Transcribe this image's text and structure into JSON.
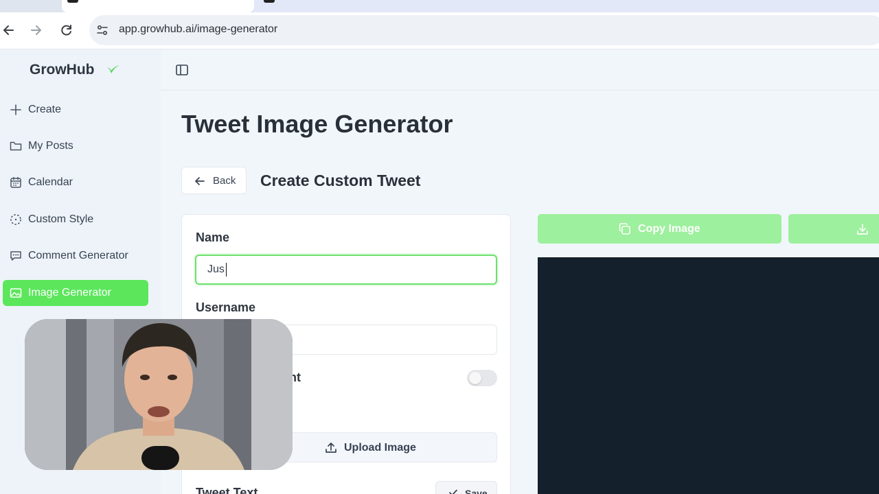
{
  "browser": {
    "url": "app.growhub.ai/image-generator"
  },
  "app": {
    "logo": "GrowHub"
  },
  "sidebar": {
    "items": [
      {
        "label": "Create",
        "icon": "plus-icon"
      },
      {
        "label": "My Posts",
        "icon": "folder-icon"
      },
      {
        "label": "Calendar",
        "icon": "calendar-icon"
      },
      {
        "label": "Custom Style",
        "icon": "dashed-circle-icon"
      },
      {
        "label": "Comment Generator",
        "icon": "comment-icon"
      },
      {
        "label": "Image Generator",
        "icon": "image-icon",
        "active": true
      }
    ]
  },
  "main": {
    "title": "Tweet Image Generator",
    "back_label": "Back",
    "subtitle": "Create Custom Tweet",
    "form": {
      "name_label": "Name",
      "name_value": "Jus",
      "username_label": "Username",
      "username_value": "",
      "partial_label": "nt",
      "toggle_on": false,
      "upload_label": "Upload Image",
      "tweet_text_label": "Tweet Text",
      "save_label": "Save"
    },
    "copy_label": "Copy Image"
  },
  "colors": {
    "accent": "#5ce65c",
    "accent_light": "#9df09d",
    "preview_bg": "#14202b"
  }
}
